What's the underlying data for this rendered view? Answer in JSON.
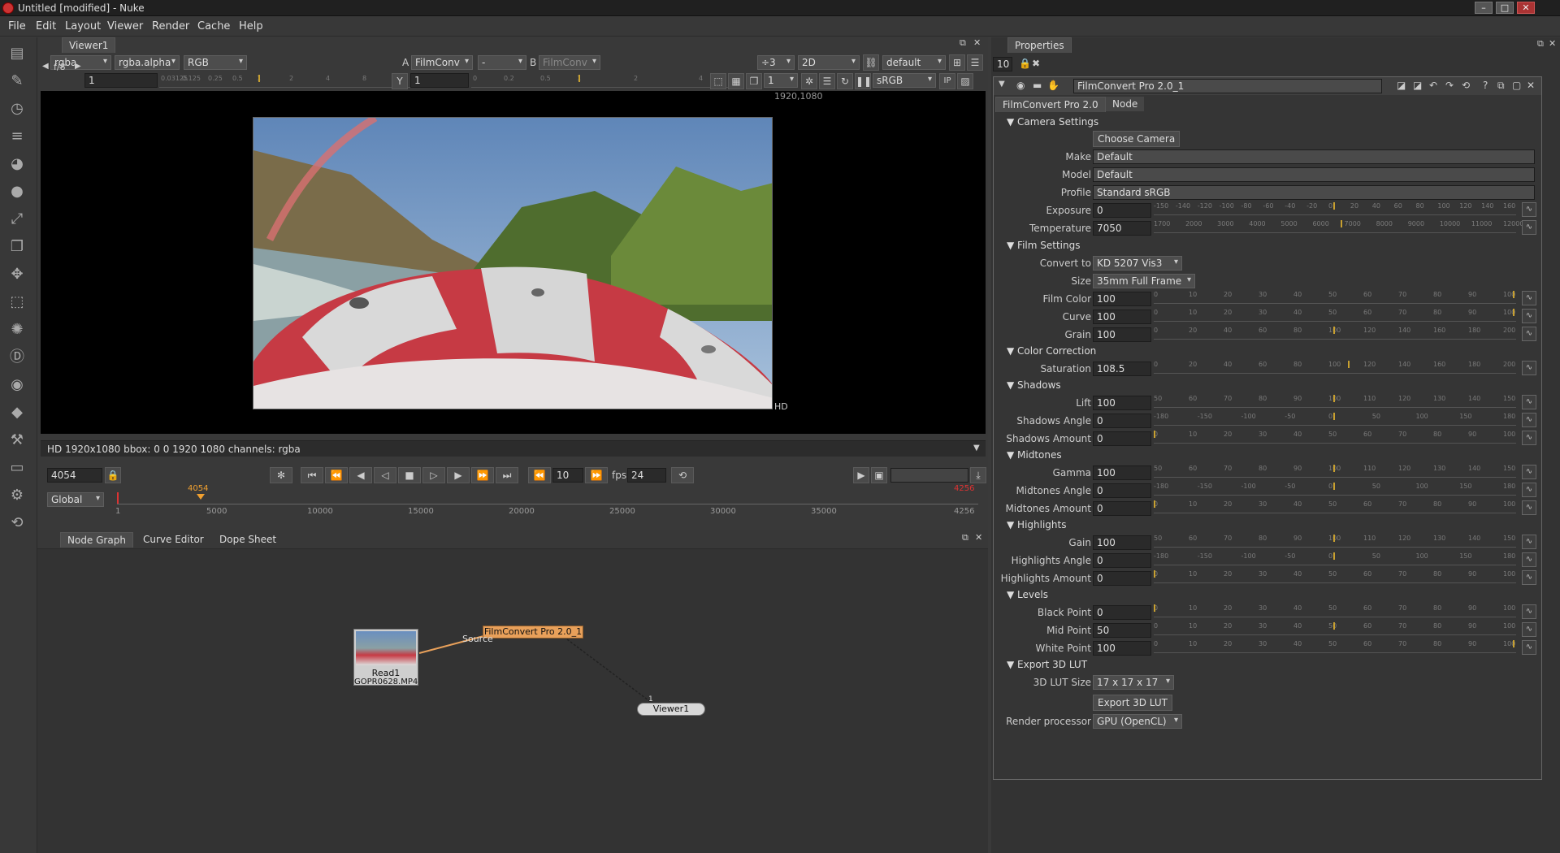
{
  "window": {
    "title": "Untitled [modified] - Nuke"
  },
  "menu": [
    "File",
    "Edit",
    "Layout",
    "Viewer",
    "Render",
    "Cache",
    "Help"
  ],
  "viewer": {
    "tab": "Viewer1",
    "channels": "rgba",
    "alpha_channel": "rgba.alpha",
    "display_channels": "RGB",
    "a_label": "A",
    "a_input": "FilmConv",
    "wipe": "-",
    "b_label": "B",
    "b_input": "FilmConv",
    "downscale": "÷3",
    "view_mode": "2D",
    "lut_default": "default",
    "fstop": "f/8",
    "gain": "1",
    "gain_ticks": [
      "0.03125",
      "0.125",
      "0.25",
      "0.5",
      "1",
      "2",
      "4",
      "8",
      "16"
    ],
    "y_label": "Y",
    "gamma": "1",
    "gamma_ticks": [
      "0",
      "0.2",
      "0.5",
      "1",
      "2",
      "4"
    ],
    "proxy": "1",
    "colorspace": "sRGB",
    "ip_label": "IP",
    "format_label": "1920,1080",
    "format_hd": "HD",
    "info_bar": "HD 1920x1080 bbox: 0 0 1920 1080 channels: rgba"
  },
  "timeline": {
    "current_frame": "4054",
    "scope": "Global",
    "marker_frame": "4054",
    "end_frame": "4256",
    "start_frame": "1",
    "ticks": [
      "5000",
      "10000",
      "15000",
      "20000",
      "25000",
      "30000",
      "35000"
    ],
    "increment": "10",
    "fps_label": "fps",
    "fps": "24"
  },
  "bottom_tabs": [
    "Node Graph",
    "Curve Editor",
    "Dope Sheet"
  ],
  "nodes": {
    "read": {
      "label": "Read1",
      "file": "GOPR0628.MP4"
    },
    "filmconvert": {
      "label": "FilmConvert Pro 2.0_1"
    },
    "viewer": {
      "label": "Viewer1",
      "input_index": "1"
    },
    "pipe_label": "Source"
  },
  "properties": {
    "panel_title": "Properties",
    "max_panels": "10",
    "node_name": "FilmConvert Pro 2.0_1",
    "tabs": [
      "FilmConvert Pro 2.0",
      "Node"
    ],
    "camera_section": "Camera Settings",
    "choose_camera": "Choose Camera",
    "make_label": "Make",
    "make": "Default",
    "model_label": "Model",
    "model": "Default",
    "profile_label": "Profile",
    "profile": "Standard sRGB",
    "exposure_label": "Exposure",
    "exposure": "0",
    "temperature_label": "Temperature",
    "temperature": "7050",
    "film_section": "Film Settings",
    "convert_label": "Convert to",
    "convert": "KD 5207 Vis3",
    "size_label": "Size",
    "size": "35mm Full Frame",
    "filmcolor_label": "Film Color",
    "filmcolor": "100",
    "curve_label": "Curve",
    "curve": "100",
    "grain_label": "Grain",
    "grain": "100",
    "cc_section": "Color Correction",
    "saturation_label": "Saturation",
    "saturation": "108.5",
    "shadows_section": "Shadows",
    "lift_label": "Lift",
    "lift": "100",
    "shadows_angle_label": "Shadows Angle",
    "shadows_angle": "0",
    "shadows_amount_label": "Shadows Amount",
    "shadows_amount": "0",
    "midtones_section": "Midtones",
    "gamma_label": "Gamma",
    "gamma": "100",
    "midtones_angle_label": "Midtones Angle",
    "midtones_angle": "0",
    "midtones_amount_label": "Midtones Amount",
    "midtones_amount": "0",
    "highlights_section": "Highlights",
    "gain_label": "Gain",
    "gain": "100",
    "highlights_angle_label": "Highlights Angle",
    "highlights_angle": "0",
    "highlights_amount_label": "Highlights Amount",
    "highlights_amount": "0",
    "levels_section": "Levels",
    "black_label": "Black Point",
    "black": "0",
    "mid_label": "Mid Point",
    "mid": "50",
    "white_label": "White Point",
    "white": "100",
    "export_section": "Export 3D LUT",
    "lutsize_label": "3D LUT Size",
    "lutsize": "17 x 17 x 17",
    "export_button": "Export 3D LUT",
    "render_label": "Render processor",
    "render": "GPU (OpenCL)"
  },
  "slider_ticks": {
    "exposure": [
      "-150",
      "-140",
      "-120",
      "-100",
      "-80",
      "-60",
      "-40",
      "-20",
      "0",
      "20",
      "40",
      "60",
      "80",
      "100",
      "120",
      "140",
      "160"
    ],
    "temperature": [
      "1700",
      "2000",
      "3000",
      "4000",
      "5000",
      "6000",
      "7000",
      "8000",
      "9000",
      "10000",
      "11000",
      "12000"
    ],
    "pct": [
      "0",
      "10",
      "20",
      "30",
      "40",
      "50",
      "60",
      "70",
      "80",
      "90",
      "100"
    ],
    "grain": [
      "0",
      "20",
      "40",
      "60",
      "80",
      "100",
      "120",
      "140",
      "160",
      "180",
      "200"
    ],
    "lift": [
      "50",
      "60",
      "70",
      "80",
      "90",
      "100",
      "110",
      "120",
      "130",
      "140",
      "150"
    ],
    "angle": [
      "-180",
      "-150",
      "-100",
      "-50",
      "0",
      "50",
      "100",
      "150",
      "180"
    ]
  },
  "colors": {
    "accent": "#f0a030",
    "node_filmconvert": "#e8a05a",
    "node_viewer": "#d8d8d8"
  }
}
